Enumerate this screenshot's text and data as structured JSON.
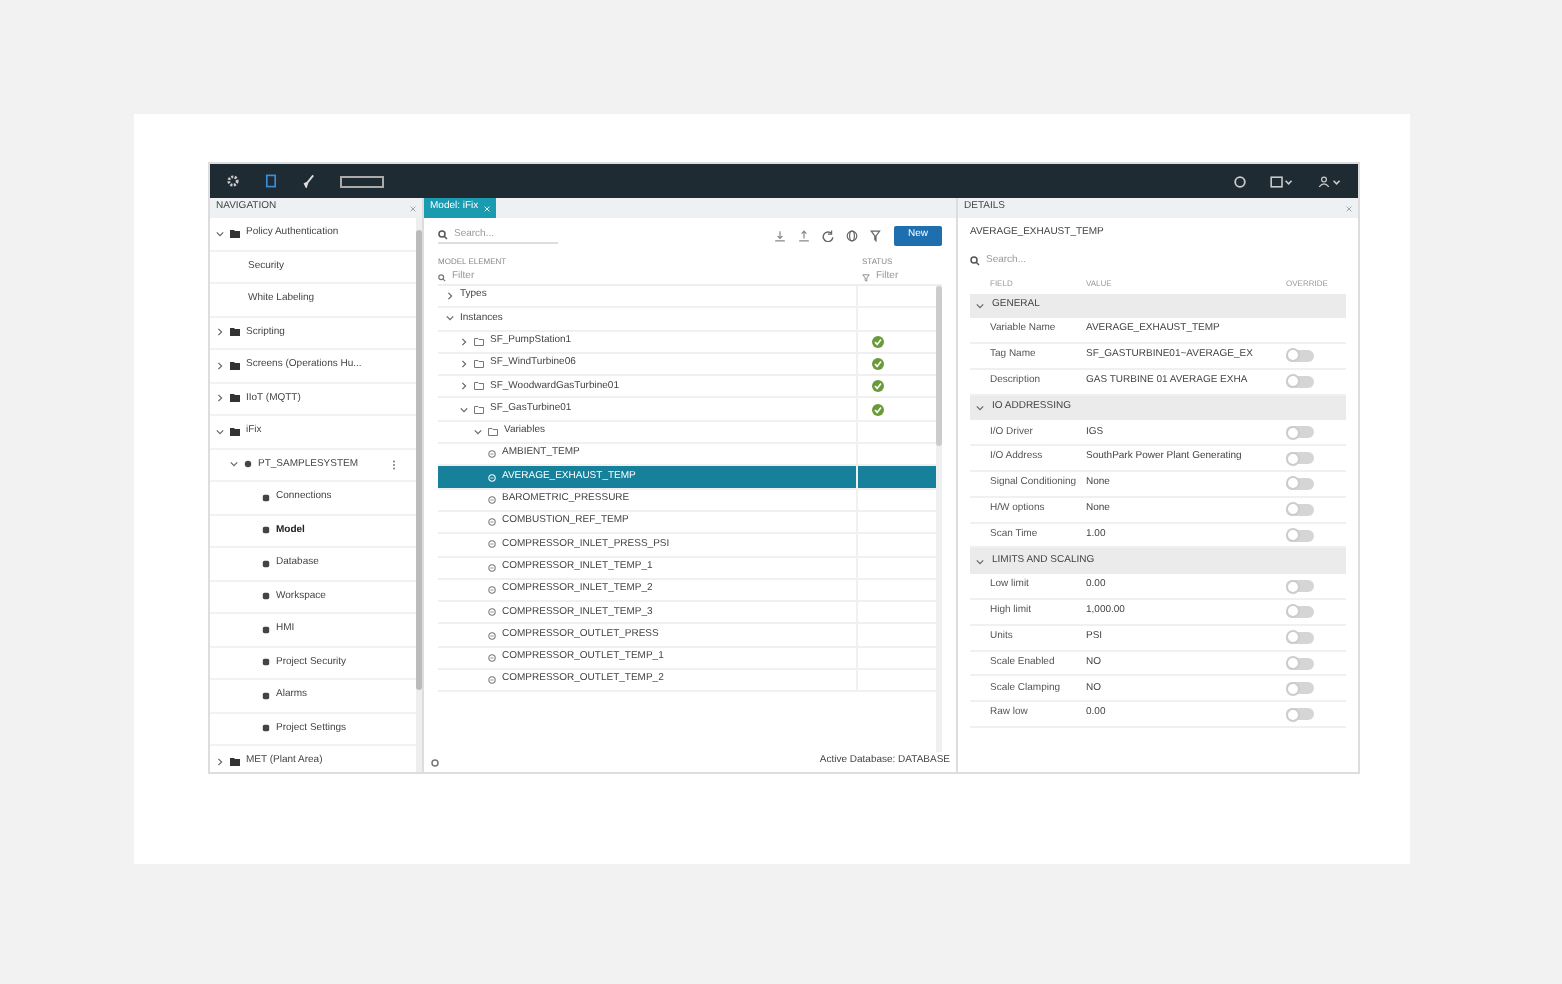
{
  "navigation": {
    "title": "NAVIGATION",
    "items": [
      {
        "label": "Policy Authentication",
        "expanded": true,
        "children": [
          {
            "label": "Security",
            "selected": false
          },
          {
            "label": "White Labeling",
            "selected": false
          }
        ]
      },
      {
        "label": "Scripting",
        "expanded": false
      },
      {
        "label": "Screens (Operations Hu...",
        "expanded": false
      },
      {
        "label": "IIoT (MQTT)",
        "expanded": false
      },
      {
        "label": "iFix",
        "expanded": true,
        "children": [
          {
            "label": "PT_SAMPLESYSTEM",
            "expanded": true,
            "children": [
              {
                "label": "Connections",
                "selected": false
              },
              {
                "label": "Model",
                "selected": true
              },
              {
                "label": "Database",
                "selected": false
              },
              {
                "label": "Workspace",
                "selected": false
              },
              {
                "label": "HMI",
                "selected": false
              },
              {
                "label": "Project Security",
                "selected": false
              },
              {
                "label": "Alarms",
                "selected": false
              },
              {
                "label": "Project Settings",
                "selected": false
              }
            ]
          }
        ]
      },
      {
        "label": "MET (Plant Area)",
        "expanded": false
      }
    ]
  },
  "tab": {
    "label": "Model: iFix",
    "selected": true
  },
  "model": {
    "search_placeholder": "Search...",
    "new_button": "New",
    "columns": [
      "MODEL ELEMENT",
      "STATUS"
    ],
    "filter_placeholders": [
      "Filter",
      "Filter"
    ],
    "tree": [
      {
        "label": "Types",
        "expanded": false
      },
      {
        "label": "Instances",
        "expanded": true,
        "children": [
          {
            "label": "SF_PumpStation1",
            "kind": "folder",
            "expanded": false,
            "status_ok": true
          },
          {
            "label": "SF_WindTurbine06",
            "kind": "folder",
            "expanded": false,
            "status_ok": true
          },
          {
            "label": "SF_WoodwardGasTurbine01",
            "kind": "folder",
            "expanded": false,
            "status_ok": true
          },
          {
            "label": "SF_GasTurbine01",
            "kind": "folder",
            "expanded": true,
            "status_ok": true,
            "children": [
              {
                "label": "Variables",
                "kind": "folder",
                "expanded": true,
                "children": [
                  {
                    "label": "AMBIENT_TEMP",
                    "kind": "variable",
                    "selected": false
                  },
                  {
                    "label": "AVERAGE_EXHAUST_TEMP",
                    "kind": "variable",
                    "selected": true
                  },
                  {
                    "label": "BAROMETRIC_PRESSURE",
                    "kind": "variable",
                    "selected": false
                  },
                  {
                    "label": "COMBUSTION_REF_TEMP",
                    "kind": "variable",
                    "selected": false
                  },
                  {
                    "label": "COMPRESSOR_INLET_PRESS_PSI",
                    "kind": "variable",
                    "selected": false
                  },
                  {
                    "label": "COMPRESSOR_INLET_TEMP_1",
                    "kind": "variable",
                    "selected": false
                  },
                  {
                    "label": "COMPRESSOR_INLET_TEMP_2",
                    "kind": "variable",
                    "selected": false
                  },
                  {
                    "label": "COMPRESSOR_INLET_TEMP_3",
                    "kind": "variable",
                    "selected": false
                  },
                  {
                    "label": "COMPRESSOR_OUTLET_PRESS",
                    "kind": "variable",
                    "selected": false
                  },
                  {
                    "label": "COMPRESSOR_OUTLET_TEMP_1",
                    "kind": "variable",
                    "selected": false
                  },
                  {
                    "label": "COMPRESSOR_OUTLET_TEMP_2",
                    "kind": "variable",
                    "selected": false
                  }
                ]
              }
            ]
          }
        ]
      }
    ],
    "footer": "Active Database: DATABASE"
  },
  "details": {
    "title": "DETAILS",
    "subject": "AVERAGE_EXHAUST_TEMP",
    "search_placeholder": "Search...",
    "columns": [
      "FIELD",
      "VALUE",
      "OVERRIDE"
    ],
    "sections": [
      {
        "title": "GENERAL",
        "expanded": true,
        "rows": [
          {
            "field": "Variable Name",
            "value": "AVERAGE_EXHAUST_TEMP"
          },
          {
            "field": "Tag Name",
            "value": "SF_GASTURBINE01~AVERAGE_EX",
            "override": false
          },
          {
            "field": "Description",
            "value": "GAS TURBINE 01 AVERAGE EXHA",
            "override": false
          }
        ]
      },
      {
        "title": "IO ADDRESSING",
        "expanded": true,
        "rows": [
          {
            "field": "I/O Driver",
            "value": "IGS",
            "override": false
          },
          {
            "field": "I/O Address",
            "value": "SouthPark Power Plant Generating",
            "override": false
          },
          {
            "field": "Signal Conditioning",
            "value": "None",
            "override": false
          },
          {
            "field": "H/W options",
            "value": "None",
            "override": false
          },
          {
            "field": "Scan Time",
            "value": "1.00",
            "override": false
          }
        ]
      },
      {
        "title": "LIMITS AND SCALING",
        "expanded": true,
        "rows": [
          {
            "field": "Low limit",
            "value": "0.00",
            "override": false
          },
          {
            "field": "High limit",
            "value": "1,000.00",
            "override": false
          },
          {
            "field": "Units",
            "value": "PSI",
            "override": false
          },
          {
            "field": "Scale Enabled",
            "value": "NO",
            "override": false
          },
          {
            "field": "Scale Clamping",
            "value": "NO",
            "override": false
          },
          {
            "field": "Raw low",
            "value": "0.00",
            "override": false
          }
        ]
      }
    ]
  }
}
